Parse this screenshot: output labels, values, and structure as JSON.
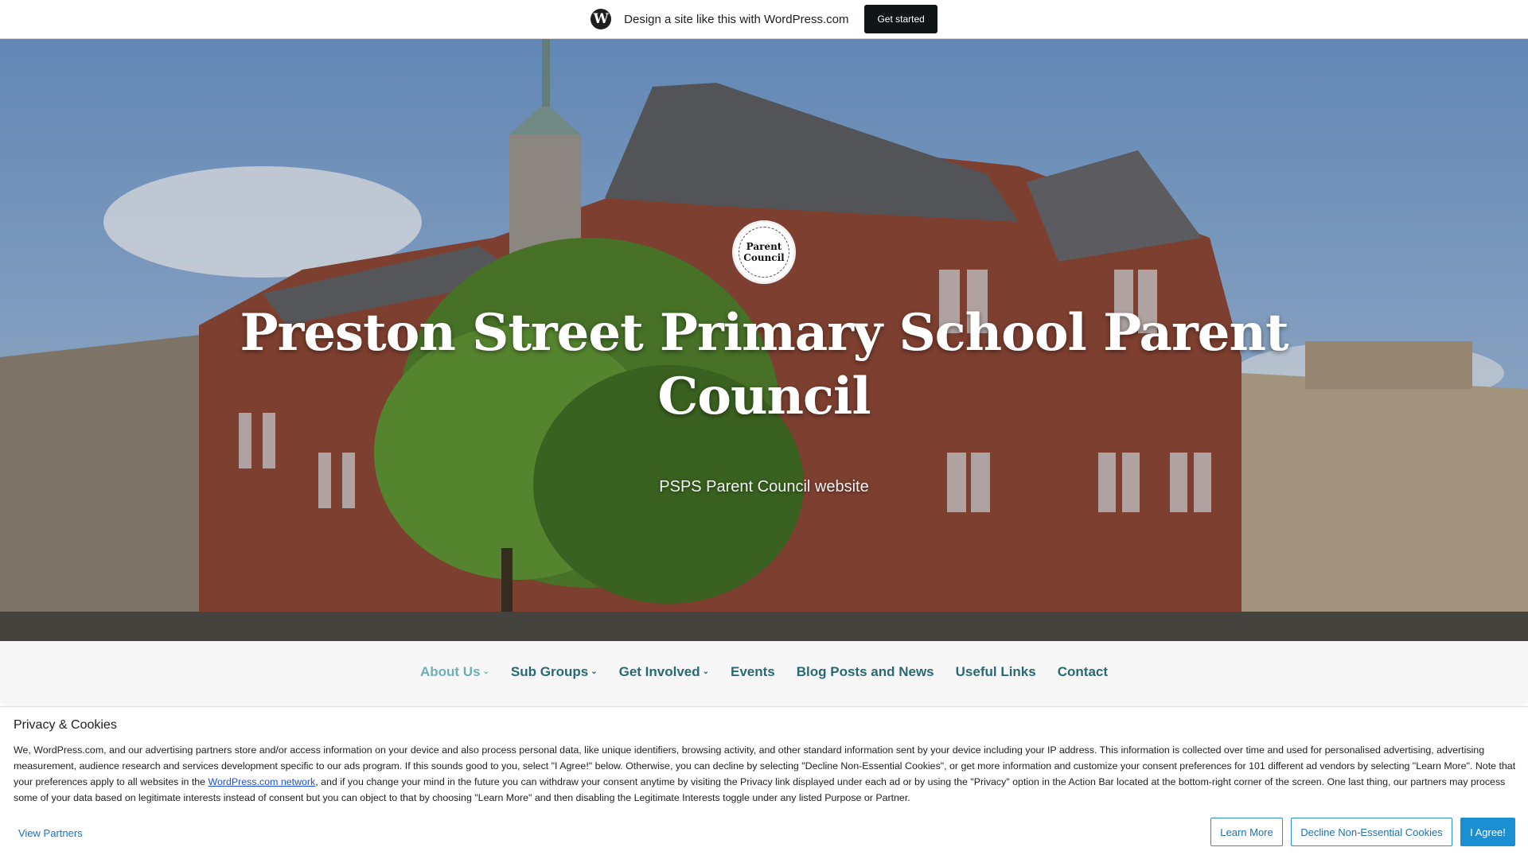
{
  "wpbar": {
    "logo_glyph": "W",
    "text": "Design a site like this with WordPress.com",
    "cta": "Get started"
  },
  "hero": {
    "logo_line1": "Parent",
    "logo_line2": "Council",
    "title": "Preston Street Primary School Parent Council",
    "tagline": "PSPS Parent Council website"
  },
  "nav": {
    "items": [
      {
        "label": "About Us",
        "has_submenu": true,
        "active": true
      },
      {
        "label": "Sub Groups",
        "has_submenu": true
      },
      {
        "label": "Get Involved",
        "has_submenu": true
      },
      {
        "label": "Events"
      },
      {
        "label": "Blog Posts and News"
      },
      {
        "label": "Useful Links"
      },
      {
        "label": "Contact"
      }
    ],
    "chevron": "›"
  },
  "cookie": {
    "title": "Privacy & Cookies",
    "text_part1": "We, WordPress.com, and our advertising partners store and/or access information on your device and also process personal data, like unique identifiers, browsing activity, and other standard information sent by your device including your IP address. This information is collected over time and used for personalised advertising, advertising measurement, audience research and services development specific to our ads program. If this sounds good to you, select \"I Agree!\" below. Otherwise, you can decline by selecting \"Decline Non-Essential Cookies\", or get more information and customize your consent preferences for 101 different ad vendors by selecting \"Learn More\". Note that your preferences apply to all websites in the ",
    "link": "WordPress.com network",
    "text_part2": ", and if you change your mind in the future you can withdraw your consent anytime by visiting the Privacy link displayed under each ad or by using the \"Privacy\" option in the Action Bar located at the bottom-right corner of the screen. One last thing, our partners may process some of your data based on legitimate interests instead of consent but you can object to that by choosing \"Learn More\" and then disabling the Legitimate Interests toggle under any listed Purpose or Partner.",
    "view_partners": "View Partners",
    "learn_more": "Learn More",
    "decline": "Decline Non-Essential Cookies",
    "agree": "I Agree!"
  },
  "colors": {
    "nav_link": "#276a75",
    "nav_active": "#6fb0b8",
    "button_blue": "#1a8fd1"
  }
}
